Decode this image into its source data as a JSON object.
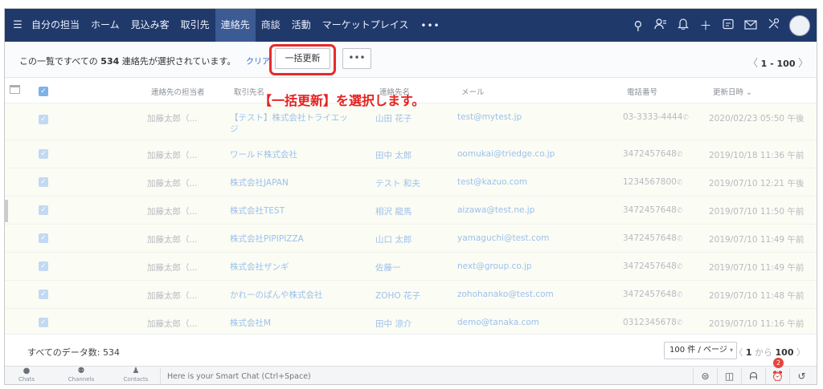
{
  "nav": {
    "items": [
      "自分の担当",
      "ホーム",
      "見込み客",
      "取引先",
      "連絡先",
      "商談",
      "活動",
      "マーケットプレイス"
    ],
    "active_index": 4,
    "more_label": "•••",
    "icons": [
      "search-icon",
      "user-group-icon",
      "bell-icon",
      "plus-icon",
      "calendar-icon",
      "mail-icon",
      "settings-icon"
    ]
  },
  "selection": {
    "prefix": "この一覧ですべての",
    "count": "534",
    "suffix": "連絡先が選択されています。",
    "clear_label": "クリア",
    "mass_update_label": "一括更新",
    "more_label": "•••",
    "page_range": "1 - 100"
  },
  "annotation": "【一括更新】を選択します。",
  "table": {
    "headers": {
      "owner": "連絡先の担当者",
      "account": "取引先名",
      "name": "連絡先名",
      "email": "メール",
      "phone": "電話番号",
      "modified": "更新日時"
    },
    "rows": [
      {
        "owner": "加藤太郎（...",
        "account": "【テスト】株式会社トライエッジ",
        "name": "山田 花子",
        "email": "test@mytest.jp",
        "phone": "03-3333-4444",
        "modified": "2020/02/23 05:50 午後"
      },
      {
        "owner": "加藤太郎（...",
        "account": "ワールド株式会社",
        "name": "田中 太郎",
        "email": "oomukai@triedge.co.jp",
        "phone": "3472457648",
        "modified": "2019/10/18 11:36 午前"
      },
      {
        "owner": "加藤太郎（...",
        "account": "株式会社JAPAN",
        "name": "テスト 和夫",
        "email": "test@kazuo.com",
        "phone": "1234567800",
        "modified": "2019/07/10 12:21 午後"
      },
      {
        "owner": "加藤太郎（...",
        "account": "株式会社TEST",
        "name": "相沢 龍馬",
        "email": "aizawa@test.ne.jp",
        "phone": "3472457648",
        "modified": "2019/07/10 11:50 午前"
      },
      {
        "owner": "加藤太郎（...",
        "account": "株式会社PIPIPIZZA",
        "name": "山口 太郎",
        "email": "yamaguchi@test.com",
        "phone": "3472457648",
        "modified": "2019/07/10 11:49 午前"
      },
      {
        "owner": "加藤太郎（...",
        "account": "株式会社ザンギ",
        "name": "佐藤一",
        "email": "next@group.co.jp",
        "phone": "3472457648",
        "modified": "2019/07/10 11:49 午前"
      },
      {
        "owner": "加藤太郎（...",
        "account": "かれーのぱんや株式会社",
        "name": "ZOHO 花子",
        "email": "zohohanako@test.com",
        "phone": "3472457648",
        "modified": "2019/07/10 11:48 午前"
      },
      {
        "owner": "加藤太郎（...",
        "account": "株式会社M",
        "name": "田中 涼介",
        "email": "demo@tanaka.com",
        "phone": "0312345678",
        "modified": "2019/07/10 11:16 午前"
      }
    ]
  },
  "footer": {
    "total_label": "すべてのデータ数: 534",
    "per_page": "100 件 / ページ",
    "range_from": "1",
    "range_mid": "から",
    "range_to": "100"
  },
  "chatbar": {
    "tabs": [
      "Chats",
      "Channels",
      "Contacts"
    ],
    "placeholder": "Here is your Smart Chat (Ctrl+Space)",
    "badge_count": "2"
  },
  "colors": {
    "nav_bg": "#20396b",
    "nav_active": "#3c5a94",
    "highlight": "#e52b2b",
    "link": "#2b6cd8"
  }
}
